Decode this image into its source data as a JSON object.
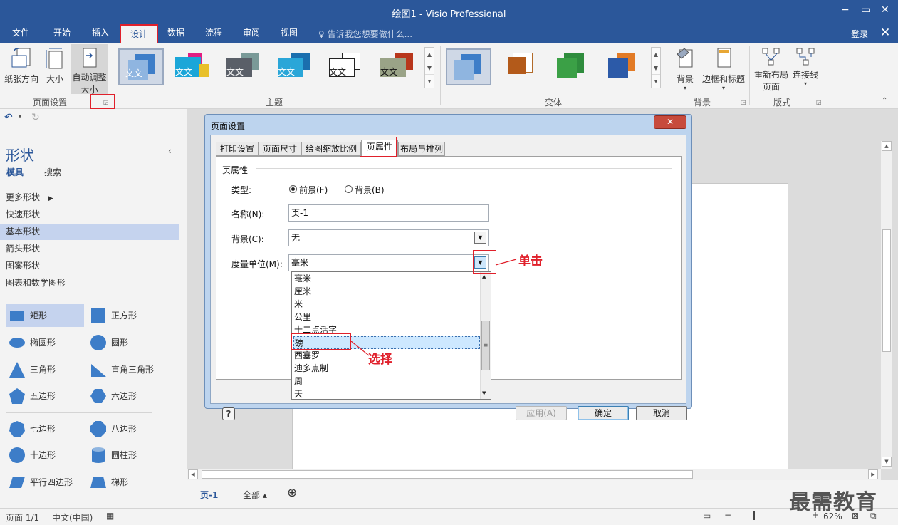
{
  "window": {
    "title": "绘图1 - Visio Professional",
    "minimize": "−",
    "restore": "▭",
    "close": "✕"
  },
  "ribbon_tabs": [
    "文件",
    "开始",
    "插入",
    "设计",
    "数据",
    "流程",
    "审阅",
    "视图"
  ],
  "active_tab": "设计",
  "tell_me": "告诉我您想要做什么...",
  "login": "登录",
  "ribbon_close": "✕",
  "page_setup_group": {
    "label": "页面设置",
    "orientation": "纸张方向",
    "size": "大小",
    "auto_size_line1": "自动调整",
    "auto_size_line2": "大小"
  },
  "themes_group": {
    "label": "主题",
    "theme_text": "文文"
  },
  "variants_group": {
    "label": "变体"
  },
  "background_group": {
    "label": "背景",
    "background": "背景",
    "borders_titles": "边框和标题"
  },
  "layout_group": {
    "label": "版式",
    "relayout_line1": "重新布局",
    "relayout_line2": "页面",
    "connectors": "连接线"
  },
  "shapes_pane": {
    "title": "形状",
    "collapse": "‹",
    "tab_stencils": "模具",
    "tab_search": "搜索",
    "more_shapes": "更多形状",
    "stencils": [
      "快速形状",
      "基本形状",
      "箭头形状",
      "图案形状",
      "图表和数学图形"
    ],
    "active_stencil": "基本形状",
    "shapes": [
      "矩形",
      "正方形",
      "椭圆形",
      "圆形",
      "三角形",
      "直角三角形",
      "五边形",
      "六边形",
      "七边形",
      "八边形",
      "十边形",
      "圆柱形",
      "平行四边形",
      "梯形"
    ],
    "active_shape": "矩形"
  },
  "dialog": {
    "title": "页面设置",
    "close": "✕",
    "tabs": [
      "打印设置",
      "页面尺寸",
      "绘图缩放比例",
      "页属性",
      "布局与排列"
    ],
    "active_tab": "页属性",
    "section_title": "页属性",
    "type_label": "类型:",
    "type_foreground": "前景(F)",
    "type_background": "背景(B)",
    "name_label": "名称(N):",
    "name_value": "页-1",
    "background_label": "背景(C):",
    "background_value": "无",
    "units_label": "度量单位(M):",
    "units_value": "毫米",
    "units_options": [
      "毫米",
      "厘米",
      "米",
      "公里",
      "十二点活字",
      "磅",
      "西塞罗",
      "迪多点制",
      "周",
      "天"
    ],
    "units_selected": "磅",
    "help": "?",
    "apply": "应用(A)",
    "ok": "确定",
    "cancel": "取消"
  },
  "annotations": {
    "click": "单击",
    "select": "选择"
  },
  "page_tabs": {
    "current": "页-1",
    "all": "全部 ▴",
    "add": "⊕"
  },
  "status": {
    "page": "页面 1/1",
    "language": "中文(中国)",
    "zoom": "62%",
    "zoom_minus": "−",
    "zoom_plus": "+"
  },
  "watermark": "最需教育",
  "colors": {
    "accent": "#2b579a",
    "annotation": "#e0202b",
    "selection": "#c5d3ee"
  }
}
